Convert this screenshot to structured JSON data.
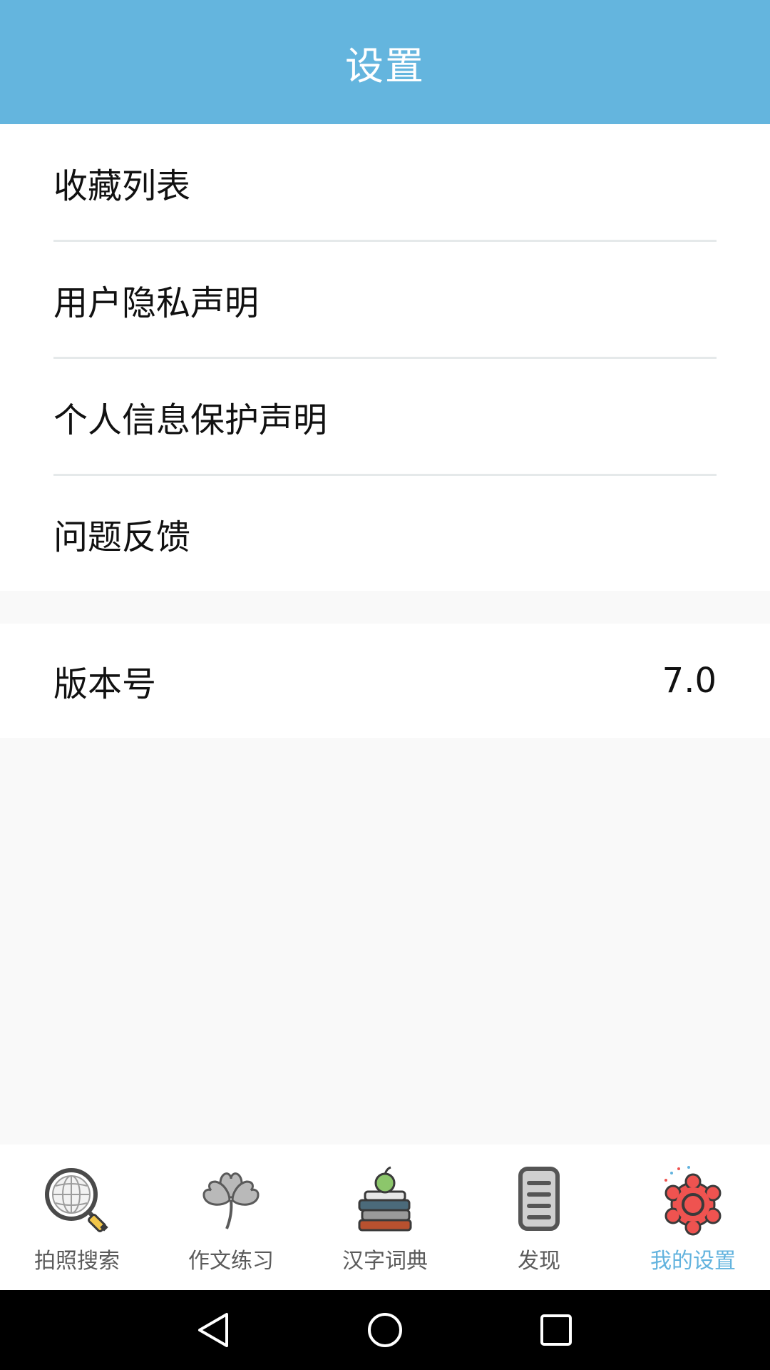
{
  "header": {
    "title": "设置"
  },
  "settings": {
    "items": [
      {
        "label": "收藏列表"
      },
      {
        "label": "用户隐私声明"
      },
      {
        "label": "个人信息保护声明"
      },
      {
        "label": "问题反馈"
      }
    ],
    "version": {
      "label": "版本号",
      "value": "7.0"
    }
  },
  "tabbar": {
    "active_index": 4,
    "active_color": "#62b3de",
    "tabs": [
      {
        "label": "拍照搜索",
        "icon": "globe-magnifier-icon"
      },
      {
        "label": "作文练习",
        "icon": "clover-icon"
      },
      {
        "label": "汉字词典",
        "icon": "books-apple-icon"
      },
      {
        "label": "发现",
        "icon": "document-icon"
      },
      {
        "label": "我的设置",
        "icon": "gear-icon"
      }
    ]
  },
  "navbar": {
    "buttons": [
      "back-triangle-icon",
      "home-circle-icon",
      "recents-square-icon"
    ]
  },
  "colors": {
    "header_bg": "#64b5de",
    "page_bg": "#f9f9f9",
    "text": "#111111",
    "tab_text": "#5b5b5b"
  }
}
